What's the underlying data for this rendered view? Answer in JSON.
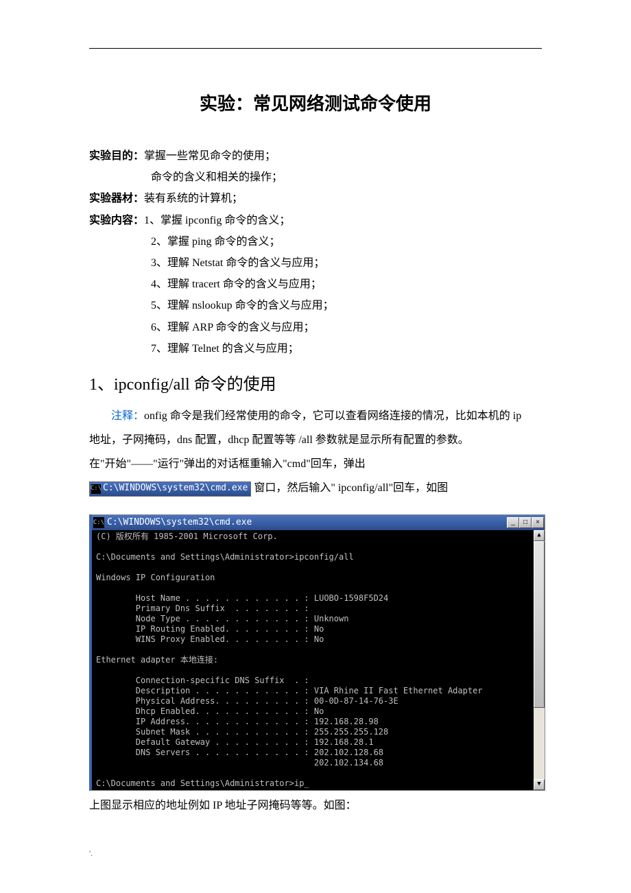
{
  "title": "实验：常见网络测试命令使用",
  "labels": {
    "objective": "实验目的：",
    "equipment": "实验器材：",
    "content": "实验内容："
  },
  "objective_lines": [
    "掌握一些常见命令的使用；",
    "命令的含义和相关的操作；"
  ],
  "equipment_line": "装有系统的计算机；",
  "content_items": [
    "1、掌握 ipconfig 命令的含义；",
    "2、掌握 ping 命令的含义；",
    "3、理解 Netstat 命令的含义与应用；",
    "4、理解 tracert 命令的含义与应用；",
    "5、理解 nslookup 命令的含义与应用；",
    "6、理解 ARP 命令的含义与应用；",
    "7、理解 Telnet 的含义与应用；"
  ],
  "section1_heading": "1、ipconfig/all 命令的使用",
  "note_label": "注释：",
  "note_text_1": "onfig 命令是我们经常使用的命令，它可以查看网络连接的情况，比如本机的 ip",
  "note_text_2": "地址，子网掩码，dns 配置，dhcp 配置等等 /all 参数就是显示所有配置的参数。",
  "note_text_3": "在\"开始\"——\"运行\"弹出的对话框重输入\"cmd\"回车，弹出",
  "inline_cmd_title": "C:\\WINDOWS\\system32\\cmd.exe",
  "after_inline": "窗口，然后输入\" ipconfig/all\"回车，如图",
  "cmd_window": {
    "title": "C:\\WINDOWS\\system32\\cmd.exe",
    "icon_text": "C:\\",
    "minimize": "_",
    "maximize": "□",
    "close": "×",
    "scroll_up": "▲",
    "scroll_down": "▼",
    "body": "(C) 版权所有 1985-2001 Microsoft Corp.\n\nC:\\Documents and Settings\\Administrator>ipconfig/all\n\nWindows IP Configuration\n\n        Host Name . . . . . . . . . . . . : LUOBO-1598F5D24\n        Primary Dns Suffix  . . . . . . . :\n        Node Type . . . . . . . . . . . . : Unknown\n        IP Routing Enabled. . . . . . . . : No\n        WINS Proxy Enabled. . . . . . . . : No\n\nEthernet adapter 本地连接:\n\n        Connection-specific DNS Suffix  . :\n        Description . . . . . . . . . . . : VIA Rhine II Fast Ethernet Adapter\n        Physical Address. . . . . . . . . : 00-0D-87-14-76-3E\n        Dhcp Enabled. . . . . . . . . . . : No\n        IP Address. . . . . . . . . . . . : 192.168.28.98\n        Subnet Mask . . . . . . . . . . . : 255.255.255.128\n        Default Gateway . . . . . . . . . : 192.168.28.1\n        DNS Servers . . . . . . . . . . . : 202.102.128.68\n                                            202.102.134.68\n\nC:\\Documents and Settings\\Administrator>ip_"
  },
  "caption_below": "上图显示相应的地址例如 IP 地址子网掩码等等。如图：",
  "footer": "'."
}
